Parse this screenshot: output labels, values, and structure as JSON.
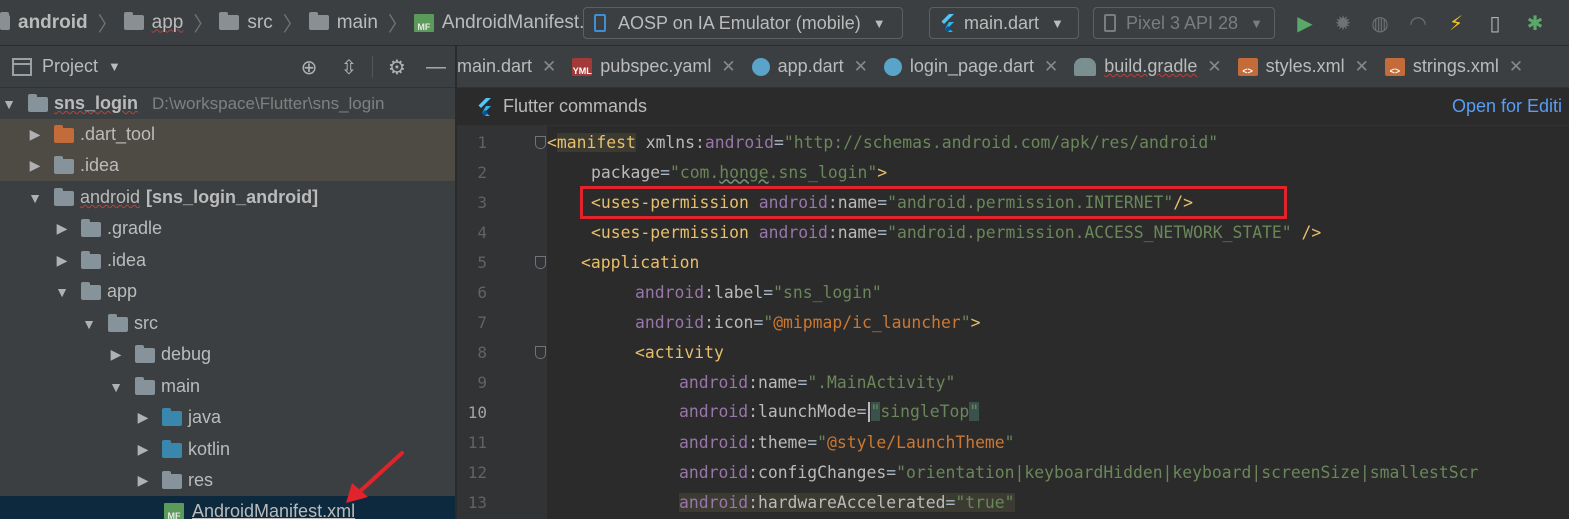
{
  "breadcrumb": {
    "items": [
      "android",
      "app",
      "src",
      "main",
      "AndroidManifest.xml"
    ]
  },
  "toolbar": {
    "device_selector": "AOSP on IA Emulator (mobile)",
    "run_config": "main.dart",
    "avd": "Pixel 3 API 28"
  },
  "sidebar": {
    "title": "Project",
    "root": {
      "name": "sns_login",
      "path": "D:\\workspace\\Flutter\\sns_login"
    },
    "items": [
      {
        "label": ".dart_tool"
      },
      {
        "label": ".idea"
      },
      {
        "label": "android",
        "module": "[sns_login_android]"
      },
      {
        "label": ".gradle"
      },
      {
        "label": ".idea"
      },
      {
        "label": "app"
      },
      {
        "label": "src"
      },
      {
        "label": "debug"
      },
      {
        "label": "main"
      },
      {
        "label": "java"
      },
      {
        "label": "kotlin"
      },
      {
        "label": "res"
      },
      {
        "label": "AndroidManifest.xml"
      }
    ]
  },
  "tabs": [
    {
      "label": "main.dart",
      "icon": "dart-file-icon"
    },
    {
      "label": "pubspec.yaml",
      "icon": "yaml-file-icon",
      "badge": "YML"
    },
    {
      "label": "app.dart",
      "icon": "dart-file-icon"
    },
    {
      "label": "login_page.dart",
      "icon": "dart-file-icon"
    },
    {
      "label": "build.gradle",
      "icon": "gradle-file-icon"
    },
    {
      "label": "styles.xml",
      "icon": "xml-file-icon"
    },
    {
      "label": "strings.xml",
      "icon": "xml-file-icon"
    }
  ],
  "flutter_bar": {
    "label": "Flutter commands",
    "link": "Open for Editi"
  },
  "editor": {
    "active_line": "10",
    "lines": [
      {
        "num": "1",
        "code": "<manifest xmlns:android=\"http://schemas.android.com/apk/res/android\""
      },
      {
        "num": "2",
        "code": "package=\"com.honge.sns_login\">"
      },
      {
        "num": "3",
        "code": "<uses-permission android:name=\"android.permission.INTERNET\"/>"
      },
      {
        "num": "4",
        "code": "<uses-permission android:name=\"android.permission.ACCESS_NETWORK_STATE\" />"
      },
      {
        "num": "5",
        "code": "<application"
      },
      {
        "num": "6",
        "code": "android:label=\"sns_login\""
      },
      {
        "num": "7",
        "code": "android:icon=\"@mipmap/ic_launcher\">"
      },
      {
        "num": "8",
        "code": "<activity"
      },
      {
        "num": "9",
        "code": "android:name=\".MainActivity\""
      },
      {
        "num": "10",
        "code": "android:launchMode=\"singleTop\""
      },
      {
        "num": "11",
        "code": "android:theme=\"@style/LaunchTheme\""
      },
      {
        "num": "12",
        "code": "android:configChanges=\"orientation|keyboardHidden|keyboard|screenSize|smallestScr"
      },
      {
        "num": "13",
        "code": "android:hardwareAccelerated=\"true\""
      }
    ]
  },
  "colors": {
    "tag": "#e8bf6a",
    "namespace": "#9876aa",
    "string": "#6a8759",
    "reference": "#cc7832",
    "link": "#589df6",
    "annotation": "#e1232b"
  }
}
